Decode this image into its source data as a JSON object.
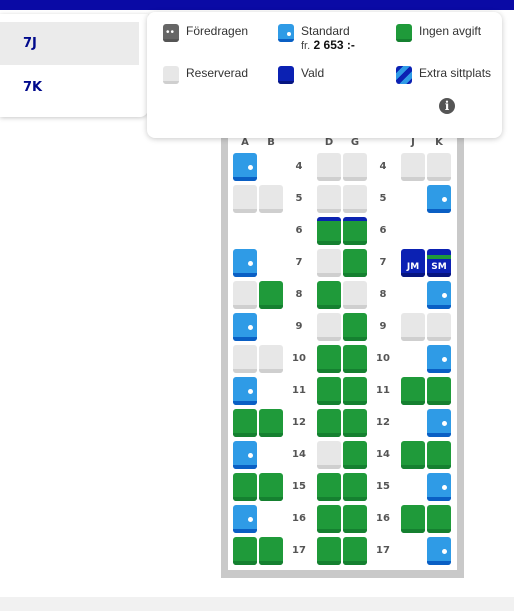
{
  "passengers": [
    {
      "label": "7J",
      "active": true
    },
    {
      "label": "7K",
      "active": false
    }
  ],
  "legend": {
    "items": [
      {
        "key": "preferred",
        "label": "Föredragen"
      },
      {
        "key": "standard",
        "label": "Standard",
        "price_prefix": "fr.",
        "price": "2 653 :-"
      },
      {
        "key": "free",
        "label": "Ingen avgift"
      },
      {
        "key": "reserved",
        "label": "Reserverad"
      },
      {
        "key": "selected",
        "label": "Vald"
      },
      {
        "key": "extra",
        "label": "Extra sittplats"
      }
    ],
    "info_icon": "info-icon"
  },
  "seat_map": {
    "columns": [
      "A",
      "B",
      "D",
      "G",
      "J",
      "K"
    ],
    "rows": [
      {
        "number": "4",
        "seats": {
          "A": "standard",
          "B": "",
          "D": "reserved",
          "G": "reserved",
          "J": "reserved",
          "K": "reserved"
        }
      },
      {
        "number": "5",
        "seats": {
          "A": "reserved",
          "B": "reserved",
          "D": "reserved",
          "G": "reserved",
          "J": "",
          "K": "standard"
        }
      },
      {
        "number": "6",
        "seats": {
          "A": "",
          "B": "",
          "D": "extra-free",
          "G": "extra-free",
          "J": "",
          "K": ""
        }
      },
      {
        "number": "7",
        "seats": {
          "A": "standard",
          "B": "",
          "D": "reserved",
          "G": "free",
          "J": "selected",
          "K": "selected"
        }
      },
      {
        "number": "8",
        "seats": {
          "A": "reserved",
          "B": "free",
          "D": "free",
          "G": "reserved",
          "J": "",
          "K": "standard"
        }
      },
      {
        "number": "9",
        "seats": {
          "A": "standard",
          "B": "",
          "D": "reserved",
          "G": "free",
          "J": "reserved",
          "K": "reserved"
        }
      },
      {
        "number": "10",
        "seats": {
          "A": "reserved",
          "B": "reserved",
          "D": "free",
          "G": "free",
          "J": "",
          "K": "standard"
        }
      },
      {
        "number": "11",
        "seats": {
          "A": "standard",
          "B": "",
          "D": "free",
          "G": "free",
          "J": "free",
          "K": "free"
        }
      },
      {
        "number": "12",
        "seats": {
          "A": "free",
          "B": "free",
          "D": "free",
          "G": "free",
          "J": "",
          "K": "standard"
        }
      },
      {
        "number": "14",
        "seats": {
          "A": "standard",
          "B": "",
          "D": "reserved",
          "G": "free",
          "J": "free",
          "K": "free"
        }
      },
      {
        "number": "15",
        "seats": {
          "A": "free",
          "B": "free",
          "D": "free",
          "G": "free",
          "J": "",
          "K": "standard"
        }
      },
      {
        "number": "16",
        "seats": {
          "A": "standard",
          "B": "",
          "D": "free",
          "G": "free",
          "J": "free",
          "K": "free"
        }
      },
      {
        "number": "17",
        "seats": {
          "A": "free",
          "B": "free",
          "D": "free",
          "G": "free",
          "J": "",
          "K": "standard"
        }
      }
    ],
    "selected_initials": {
      "7J": "JM",
      "7K": "SM"
    }
  },
  "colors": {
    "brand_blue": "#0a0aa5",
    "standard": "#2f9be6",
    "free": "#1f9a3a",
    "reserved": "#e7e7e7",
    "selected": "#0b21b3"
  }
}
